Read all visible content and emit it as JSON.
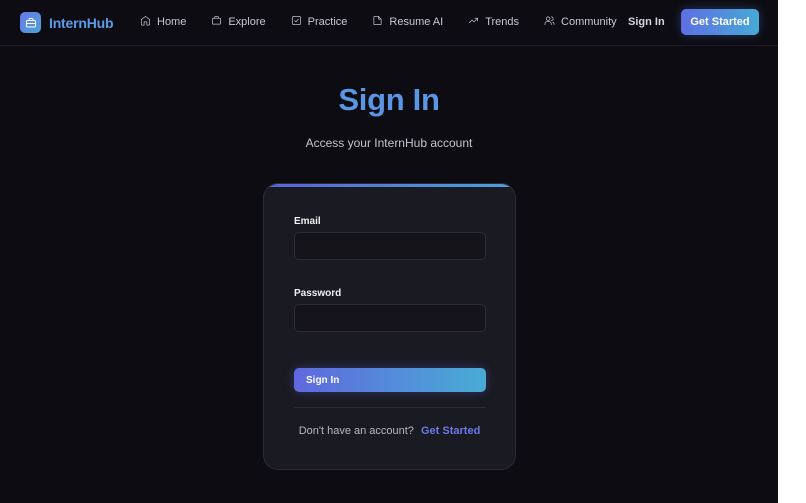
{
  "app": {
    "name": "InternHub",
    "logo_icon": "briefcase-icon"
  },
  "nav": {
    "items": [
      {
        "label": "Home",
        "icon": "home-icon"
      },
      {
        "label": "Explore",
        "icon": "briefcase-icon"
      },
      {
        "label": "Practice",
        "icon": "checkbox-icon"
      },
      {
        "label": "Resume AI",
        "icon": "document-icon"
      },
      {
        "label": "Trends",
        "icon": "trending-up-icon"
      },
      {
        "label": "Community",
        "icon": "users-icon"
      }
    ],
    "signin_label": "Sign In",
    "cta_label": "Get Started"
  },
  "page": {
    "title": "Sign In",
    "subtitle": "Access your InternHub account"
  },
  "form": {
    "email_label": "Email",
    "email_value": "",
    "password_label": "Password",
    "password_value": "",
    "submit_label": "Sign In",
    "footer_text": "Don't have an account?",
    "footer_link": "Get Started"
  },
  "colors": {
    "background": "#0d0c12",
    "accent_blue": "#5b95e3",
    "gradient_start": "#5e6fe4",
    "gradient_end": "#47a9d6",
    "card": "#1a1a22",
    "link": "#6a78ea"
  }
}
